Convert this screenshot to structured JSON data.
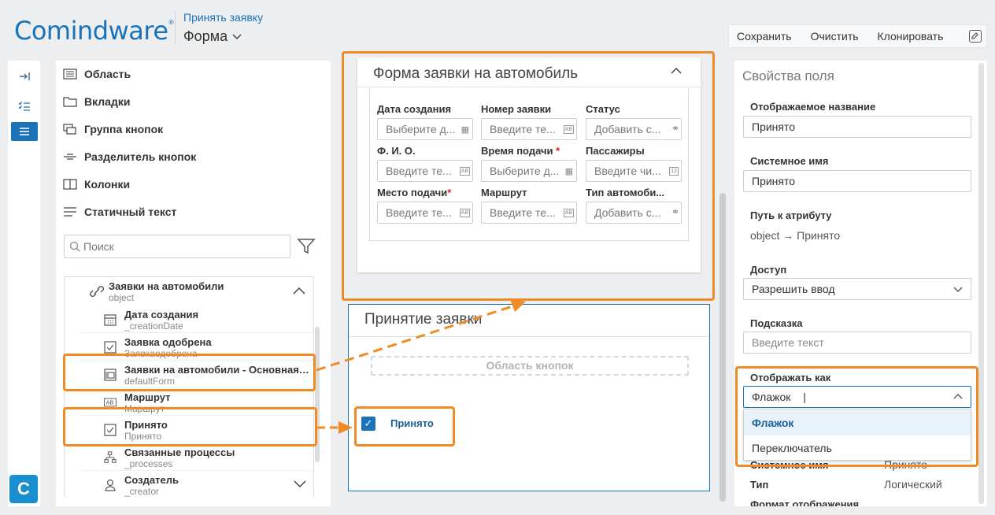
{
  "header": {
    "logo": "Comindware",
    "logo_mark": "®",
    "breadcrumb": "Принять заявку",
    "form_title": "Форма"
  },
  "toolbar": {
    "save": "Сохранить",
    "clear": "Очистить",
    "clone": "Клонировать"
  },
  "strip": {
    "logo_letter": "C"
  },
  "components": [
    {
      "label": "Область",
      "icon": "list-icon"
    },
    {
      "label": "Вкладки",
      "icon": "folder-icon"
    },
    {
      "label": "Группа кнопок",
      "icon": "button-group-icon"
    },
    {
      "label": "Разделитель кнопок",
      "icon": "divider-icon"
    },
    {
      "label": "Колонки",
      "icon": "columns-icon"
    },
    {
      "label": "Статичный текст",
      "icon": "text-icon"
    }
  ],
  "search": {
    "placeholder": "Поиск"
  },
  "tree": {
    "root": {
      "title": "Заявки на автомобили",
      "sub": "object"
    },
    "items": [
      {
        "title": "Дата создания",
        "sub": "_creationDate",
        "icon": "calendar-icon"
      },
      {
        "title": "Заявка одобрена",
        "sub": "Заявкаодобрена",
        "icon": "checkbox-icon"
      },
      {
        "title": "Заявки на автомобили - Основная ...",
        "sub": "defaultForm",
        "icon": "form-icon"
      },
      {
        "title": "Маршрут",
        "sub": "Маршрут",
        "icon": "ab-icon"
      },
      {
        "title": "Принято",
        "sub": "Принято",
        "icon": "checkbox-icon"
      },
      {
        "title": "Связанные процессы",
        "sub": "_processes",
        "icon": "process-icon"
      },
      {
        "title": "Создатель",
        "sub": "_creator",
        "icon": "user-icon"
      }
    ]
  },
  "form_card": {
    "title": "Форма заявки на автомобиль",
    "fields": [
      {
        "label": "Дата создания",
        "required": false,
        "placeholder": "Выберите д...",
        "kind": "date"
      },
      {
        "label": "Номер заявки",
        "required": false,
        "placeholder": "Введите те...",
        "kind": "text"
      },
      {
        "label": "Статус",
        "required": false,
        "placeholder": "Добавить с...",
        "kind": "link"
      },
      {
        "label": "Ф. И. О.",
        "required": false,
        "placeholder": "Введите те...",
        "kind": "text"
      },
      {
        "label": "Время подачи",
        "required": true,
        "placeholder": "Выберите д...",
        "kind": "date"
      },
      {
        "label": "Пассажиры",
        "required": false,
        "placeholder": "Введите чи...",
        "kind": "number"
      },
      {
        "label": "Место подачи",
        "required": true,
        "placeholder": "Введите те...",
        "kind": "text"
      },
      {
        "label": "Маршрут",
        "required": false,
        "placeholder": "Введите те...",
        "kind": "text"
      },
      {
        "label": "Тип автомоби...",
        "required": false,
        "placeholder": "Добавить с...",
        "kind": "link"
      }
    ],
    "tag_text": "AB",
    "tag_number": "12"
  },
  "accept_card": {
    "title": "Принятие заявки",
    "button_area": "Область кнопок",
    "checkbox_label": "Принято",
    "checked": true
  },
  "properties": {
    "title": "Свойства поля",
    "display_name_label": "Отображаемое название",
    "display_name_value": "Принято",
    "system_name_label": "Системное имя",
    "system_name_value": "Принято",
    "path_label": "Путь к атрибуту",
    "path_value": "object → Принято",
    "access_label": "Доступ",
    "access_value": "Разрешить ввод",
    "hint_label": "Подсказка",
    "hint_placeholder": "Введите текст",
    "display_as_label": "Отображать как",
    "display_as_value": "Флажок",
    "display_as_options": [
      "Флажок",
      "Переключатель"
    ],
    "system_name_label_2": "Системное имя",
    "system_name_value_2": "Принято",
    "type_label": "Тип",
    "type_value": "Логический",
    "format_label": "Формат отображения"
  },
  "colors": {
    "accent": "#1a73b8",
    "highlight": "#f08a24",
    "required": "#d9232d"
  }
}
